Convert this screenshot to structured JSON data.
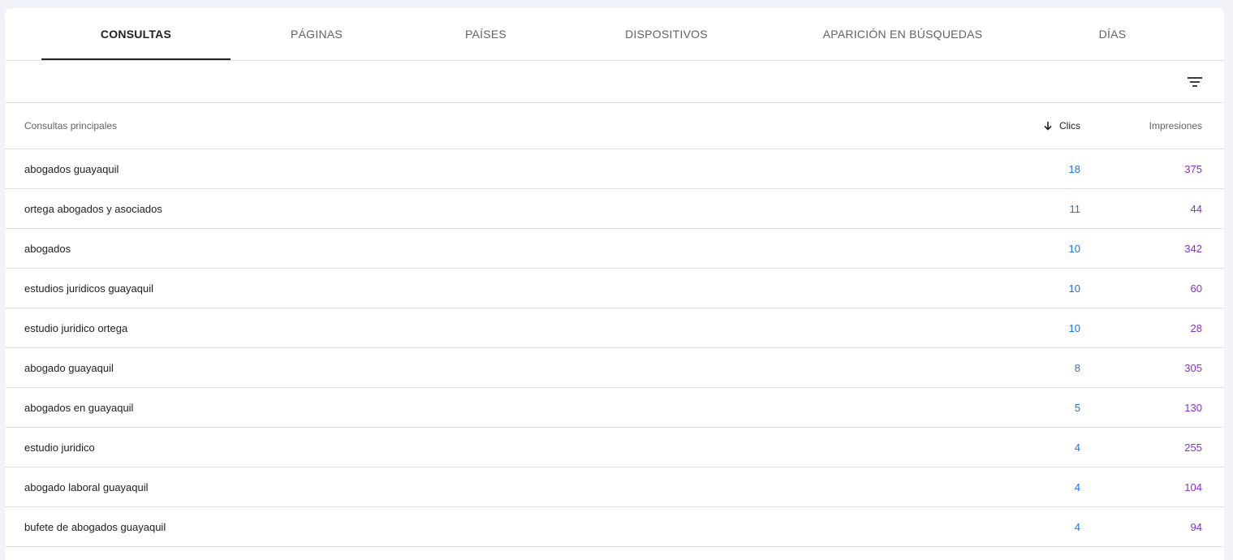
{
  "tabs": [
    {
      "label": "CONSULTAS",
      "active": true
    },
    {
      "label": "PÁGINAS"
    },
    {
      "label": "PAÍSES"
    },
    {
      "label": "DISPOSITIVOS"
    },
    {
      "label": "APARICIÓN EN BÚSQUEDAS"
    },
    {
      "label": "DÍAS"
    }
  ],
  "toolbar": {
    "filter_icon": "filter-icon"
  },
  "table": {
    "columns": {
      "query": "Consultas principales",
      "clicks": "Clics",
      "impressions": "Impresiones",
      "sort_icon": "arrow-down-icon"
    },
    "rows": [
      {
        "query": "abogados guayaquil",
        "clicks": "18",
        "impressions": "375"
      },
      {
        "query": "ortega abogados y asociados",
        "clicks": "11",
        "impressions": "44"
      },
      {
        "query": "abogados",
        "clicks": "10",
        "impressions": "342"
      },
      {
        "query": "estudios juridicos guayaquil",
        "clicks": "10",
        "impressions": "60"
      },
      {
        "query": "estudio juridico ortega",
        "clicks": "10",
        "impressions": "28"
      },
      {
        "query": "abogado guayaquil",
        "clicks": "8",
        "impressions": "305"
      },
      {
        "query": "abogados en guayaquil",
        "clicks": "5",
        "impressions": "130"
      },
      {
        "query": "estudio juridico",
        "clicks": "4",
        "impressions": "255"
      },
      {
        "query": "abogado laboral guayaquil",
        "clicks": "4",
        "impressions": "104"
      },
      {
        "query": "bufete de abogados guayaquil",
        "clicks": "4",
        "impressions": "94"
      }
    ]
  },
  "colors": {
    "clicks": "#1a73e8",
    "impressions": "#8430ce",
    "text": "#202124",
    "muted": "#5f6368",
    "divider": "#e0e0e0"
  }
}
